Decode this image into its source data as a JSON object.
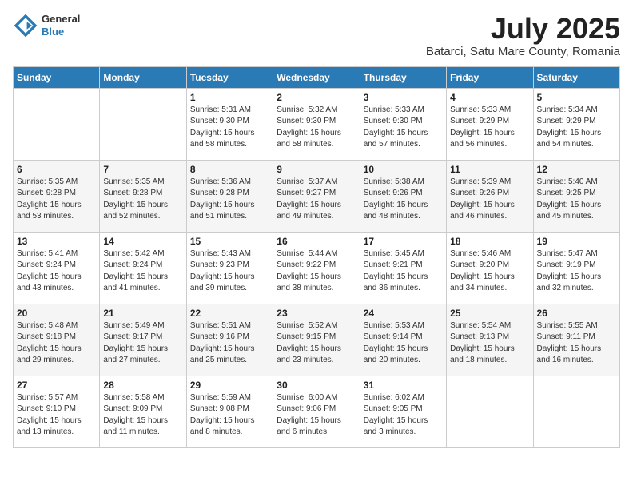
{
  "logo": {
    "line1": "General",
    "line2": "Blue"
  },
  "title": "July 2025",
  "location": "Batarci, Satu Mare County, Romania",
  "weekdays": [
    "Sunday",
    "Monday",
    "Tuesday",
    "Wednesday",
    "Thursday",
    "Friday",
    "Saturday"
  ],
  "weeks": [
    [
      {
        "day": "",
        "sunrise": "",
        "sunset": "",
        "daylight": ""
      },
      {
        "day": "",
        "sunrise": "",
        "sunset": "",
        "daylight": ""
      },
      {
        "day": "1",
        "sunrise": "Sunrise: 5:31 AM",
        "sunset": "Sunset: 9:30 PM",
        "daylight": "Daylight: 15 hours and 58 minutes."
      },
      {
        "day": "2",
        "sunrise": "Sunrise: 5:32 AM",
        "sunset": "Sunset: 9:30 PM",
        "daylight": "Daylight: 15 hours and 58 minutes."
      },
      {
        "day": "3",
        "sunrise": "Sunrise: 5:33 AM",
        "sunset": "Sunset: 9:30 PM",
        "daylight": "Daylight: 15 hours and 57 minutes."
      },
      {
        "day": "4",
        "sunrise": "Sunrise: 5:33 AM",
        "sunset": "Sunset: 9:29 PM",
        "daylight": "Daylight: 15 hours and 56 minutes."
      },
      {
        "day": "5",
        "sunrise": "Sunrise: 5:34 AM",
        "sunset": "Sunset: 9:29 PM",
        "daylight": "Daylight: 15 hours and 54 minutes."
      }
    ],
    [
      {
        "day": "6",
        "sunrise": "Sunrise: 5:35 AM",
        "sunset": "Sunset: 9:28 PM",
        "daylight": "Daylight: 15 hours and 53 minutes."
      },
      {
        "day": "7",
        "sunrise": "Sunrise: 5:35 AM",
        "sunset": "Sunset: 9:28 PM",
        "daylight": "Daylight: 15 hours and 52 minutes."
      },
      {
        "day": "8",
        "sunrise": "Sunrise: 5:36 AM",
        "sunset": "Sunset: 9:28 PM",
        "daylight": "Daylight: 15 hours and 51 minutes."
      },
      {
        "day": "9",
        "sunrise": "Sunrise: 5:37 AM",
        "sunset": "Sunset: 9:27 PM",
        "daylight": "Daylight: 15 hours and 49 minutes."
      },
      {
        "day": "10",
        "sunrise": "Sunrise: 5:38 AM",
        "sunset": "Sunset: 9:26 PM",
        "daylight": "Daylight: 15 hours and 48 minutes."
      },
      {
        "day": "11",
        "sunrise": "Sunrise: 5:39 AM",
        "sunset": "Sunset: 9:26 PM",
        "daylight": "Daylight: 15 hours and 46 minutes."
      },
      {
        "day": "12",
        "sunrise": "Sunrise: 5:40 AM",
        "sunset": "Sunset: 9:25 PM",
        "daylight": "Daylight: 15 hours and 45 minutes."
      }
    ],
    [
      {
        "day": "13",
        "sunrise": "Sunrise: 5:41 AM",
        "sunset": "Sunset: 9:24 PM",
        "daylight": "Daylight: 15 hours and 43 minutes."
      },
      {
        "day": "14",
        "sunrise": "Sunrise: 5:42 AM",
        "sunset": "Sunset: 9:24 PM",
        "daylight": "Daylight: 15 hours and 41 minutes."
      },
      {
        "day": "15",
        "sunrise": "Sunrise: 5:43 AM",
        "sunset": "Sunset: 9:23 PM",
        "daylight": "Daylight: 15 hours and 39 minutes."
      },
      {
        "day": "16",
        "sunrise": "Sunrise: 5:44 AM",
        "sunset": "Sunset: 9:22 PM",
        "daylight": "Daylight: 15 hours and 38 minutes."
      },
      {
        "day": "17",
        "sunrise": "Sunrise: 5:45 AM",
        "sunset": "Sunset: 9:21 PM",
        "daylight": "Daylight: 15 hours and 36 minutes."
      },
      {
        "day": "18",
        "sunrise": "Sunrise: 5:46 AM",
        "sunset": "Sunset: 9:20 PM",
        "daylight": "Daylight: 15 hours and 34 minutes."
      },
      {
        "day": "19",
        "sunrise": "Sunrise: 5:47 AM",
        "sunset": "Sunset: 9:19 PM",
        "daylight": "Daylight: 15 hours and 32 minutes."
      }
    ],
    [
      {
        "day": "20",
        "sunrise": "Sunrise: 5:48 AM",
        "sunset": "Sunset: 9:18 PM",
        "daylight": "Daylight: 15 hours and 29 minutes."
      },
      {
        "day": "21",
        "sunrise": "Sunrise: 5:49 AM",
        "sunset": "Sunset: 9:17 PM",
        "daylight": "Daylight: 15 hours and 27 minutes."
      },
      {
        "day": "22",
        "sunrise": "Sunrise: 5:51 AM",
        "sunset": "Sunset: 9:16 PM",
        "daylight": "Daylight: 15 hours and 25 minutes."
      },
      {
        "day": "23",
        "sunrise": "Sunrise: 5:52 AM",
        "sunset": "Sunset: 9:15 PM",
        "daylight": "Daylight: 15 hours and 23 minutes."
      },
      {
        "day": "24",
        "sunrise": "Sunrise: 5:53 AM",
        "sunset": "Sunset: 9:14 PM",
        "daylight": "Daylight: 15 hours and 20 minutes."
      },
      {
        "day": "25",
        "sunrise": "Sunrise: 5:54 AM",
        "sunset": "Sunset: 9:13 PM",
        "daylight": "Daylight: 15 hours and 18 minutes."
      },
      {
        "day": "26",
        "sunrise": "Sunrise: 5:55 AM",
        "sunset": "Sunset: 9:11 PM",
        "daylight": "Daylight: 15 hours and 16 minutes."
      }
    ],
    [
      {
        "day": "27",
        "sunrise": "Sunrise: 5:57 AM",
        "sunset": "Sunset: 9:10 PM",
        "daylight": "Daylight: 15 hours and 13 minutes."
      },
      {
        "day": "28",
        "sunrise": "Sunrise: 5:58 AM",
        "sunset": "Sunset: 9:09 PM",
        "daylight": "Daylight: 15 hours and 11 minutes."
      },
      {
        "day": "29",
        "sunrise": "Sunrise: 5:59 AM",
        "sunset": "Sunset: 9:08 PM",
        "daylight": "Daylight: 15 hours and 8 minutes."
      },
      {
        "day": "30",
        "sunrise": "Sunrise: 6:00 AM",
        "sunset": "Sunset: 9:06 PM",
        "daylight": "Daylight: 15 hours and 6 minutes."
      },
      {
        "day": "31",
        "sunrise": "Sunrise: 6:02 AM",
        "sunset": "Sunset: 9:05 PM",
        "daylight": "Daylight: 15 hours and 3 minutes."
      },
      {
        "day": "",
        "sunrise": "",
        "sunset": "",
        "daylight": ""
      },
      {
        "day": "",
        "sunrise": "",
        "sunset": "",
        "daylight": ""
      }
    ]
  ]
}
